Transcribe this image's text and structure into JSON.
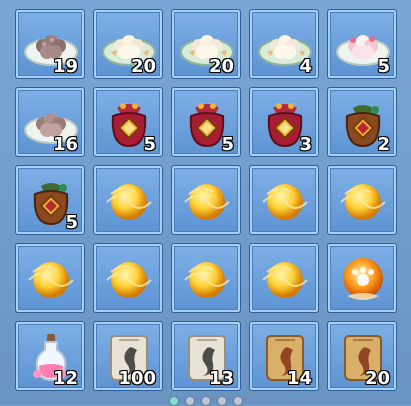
{
  "inventory": {
    "items": [
      {
        "icon": "dumpling-plate-icon",
        "count": "19"
      },
      {
        "icon": "dumpling-plate-icon",
        "count": "20"
      },
      {
        "icon": "dumpling-plate-icon",
        "count": "20"
      },
      {
        "icon": "dumpling-plate-icon",
        "count": "4"
      },
      {
        "icon": "dumpling-plate-icon",
        "count": "5"
      },
      {
        "icon": "dumpling-plate-icon",
        "count": "16"
      },
      {
        "icon": "lucky-bag-icon",
        "count": "5"
      },
      {
        "icon": "lucky-bag-icon",
        "count": "5"
      },
      {
        "icon": "lucky-bag-icon",
        "count": "3"
      },
      {
        "icon": "lucky-bag-icon",
        "count": "2"
      },
      {
        "icon": "lucky-bag-icon",
        "count": "5"
      },
      {
        "icon": "golden-orb-icon",
        "count": ""
      },
      {
        "icon": "golden-orb-icon",
        "count": ""
      },
      {
        "icon": "golden-orb-icon",
        "count": ""
      },
      {
        "icon": "golden-orb-icon",
        "count": ""
      },
      {
        "icon": "golden-orb-icon",
        "count": ""
      },
      {
        "icon": "golden-orb-icon",
        "count": ""
      },
      {
        "icon": "golden-orb-icon",
        "count": ""
      },
      {
        "icon": "golden-orb-icon",
        "count": ""
      },
      {
        "icon": "paw-orb-icon",
        "count": ""
      },
      {
        "icon": "potion-bottle-icon",
        "count": "12"
      },
      {
        "icon": "scroll-icon",
        "count": "100"
      },
      {
        "icon": "scroll-icon",
        "count": "13"
      },
      {
        "icon": "scroll-icon",
        "count": "14"
      },
      {
        "icon": "scroll-icon",
        "count": "20"
      }
    ],
    "active_page": "1"
  }
}
